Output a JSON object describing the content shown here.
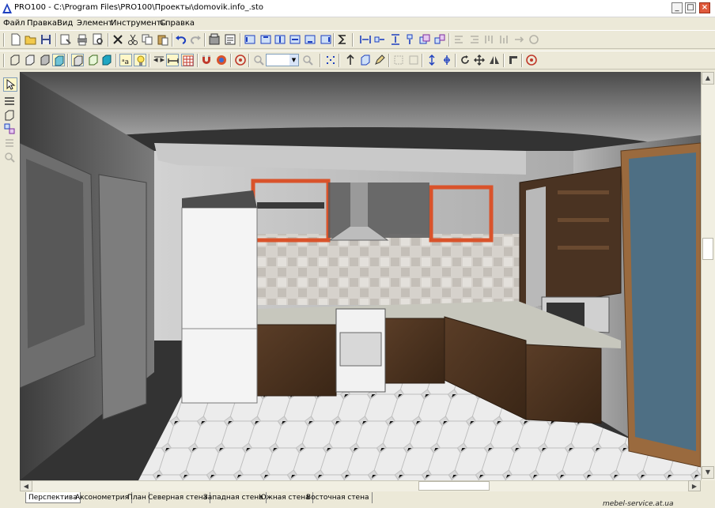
{
  "window": {
    "title": "PRO100 - C:\\Program Files\\PRO100\\Проекты\\domovik.info_.sto",
    "min_label": "_",
    "max_label": "□",
    "close_label": "×"
  },
  "menu": [
    {
      "label": "Файл"
    },
    {
      "label": "Правка"
    },
    {
      "label": "Вид"
    },
    {
      "label": "Элемент"
    },
    {
      "label": "Инструменты"
    },
    {
      "label": "Справка"
    }
  ],
  "zoom": {
    "value": ""
  },
  "tabs": [
    {
      "label": "Перспектива",
      "active": true
    },
    {
      "label": "Аксонометрия"
    },
    {
      "label": "План"
    },
    {
      "label": "Северная стена"
    },
    {
      "label": "Западная стена"
    },
    {
      "label": "Южная стена"
    },
    {
      "label": "Восточная стена"
    }
  ],
  "corner_text": "mebel-service.at.ua",
  "colors": {
    "accent_orange": "#d9532b",
    "cabinet_wood": "#4a3322",
    "wall": "#bdbdbd",
    "close_button": "#e05a3c"
  }
}
